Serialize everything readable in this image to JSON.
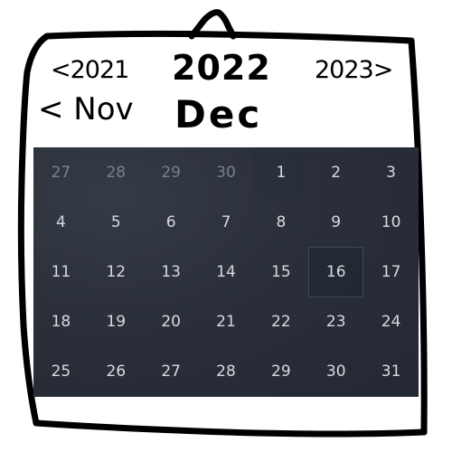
{
  "header": {
    "prev_year": "<2021",
    "current_year": "2022",
    "next_year": "2023>",
    "prev_month": "< Nov",
    "current_month": "Dec"
  },
  "calendar": {
    "today": "16",
    "days": [
      {
        "label": "27",
        "muted": true
      },
      {
        "label": "28",
        "muted": true
      },
      {
        "label": "29",
        "muted": true
      },
      {
        "label": "30",
        "muted": true
      },
      {
        "label": "1",
        "muted": false
      },
      {
        "label": "2",
        "muted": false
      },
      {
        "label": "3",
        "muted": false
      },
      {
        "label": "4",
        "muted": false
      },
      {
        "label": "5",
        "muted": false
      },
      {
        "label": "6",
        "muted": false
      },
      {
        "label": "7",
        "muted": false
      },
      {
        "label": "8",
        "muted": false
      },
      {
        "label": "9",
        "muted": false
      },
      {
        "label": "10",
        "muted": false
      },
      {
        "label": "11",
        "muted": false
      },
      {
        "label": "12",
        "muted": false
      },
      {
        "label": "13",
        "muted": false
      },
      {
        "label": "14",
        "muted": false
      },
      {
        "label": "15",
        "muted": false
      },
      {
        "label": "16",
        "muted": false
      },
      {
        "label": "17",
        "muted": false
      },
      {
        "label": "18",
        "muted": false
      },
      {
        "label": "19",
        "muted": false
      },
      {
        "label": "20",
        "muted": false
      },
      {
        "label": "21",
        "muted": false
      },
      {
        "label": "22",
        "muted": false
      },
      {
        "label": "23",
        "muted": false
      },
      {
        "label": "24",
        "muted": false
      },
      {
        "label": "25",
        "muted": false
      },
      {
        "label": "26",
        "muted": false
      },
      {
        "label": "27",
        "muted": false
      },
      {
        "label": "28",
        "muted": false
      },
      {
        "label": "29",
        "muted": false
      },
      {
        "label": "30",
        "muted": false
      },
      {
        "label": "31",
        "muted": false
      }
    ]
  },
  "colors": {
    "frame": "#000000",
    "grid_background": "#2a2f39",
    "day_text": "#d6dae0",
    "muted_day_text": "#7a808b",
    "today_border": "#3a4a5a"
  }
}
